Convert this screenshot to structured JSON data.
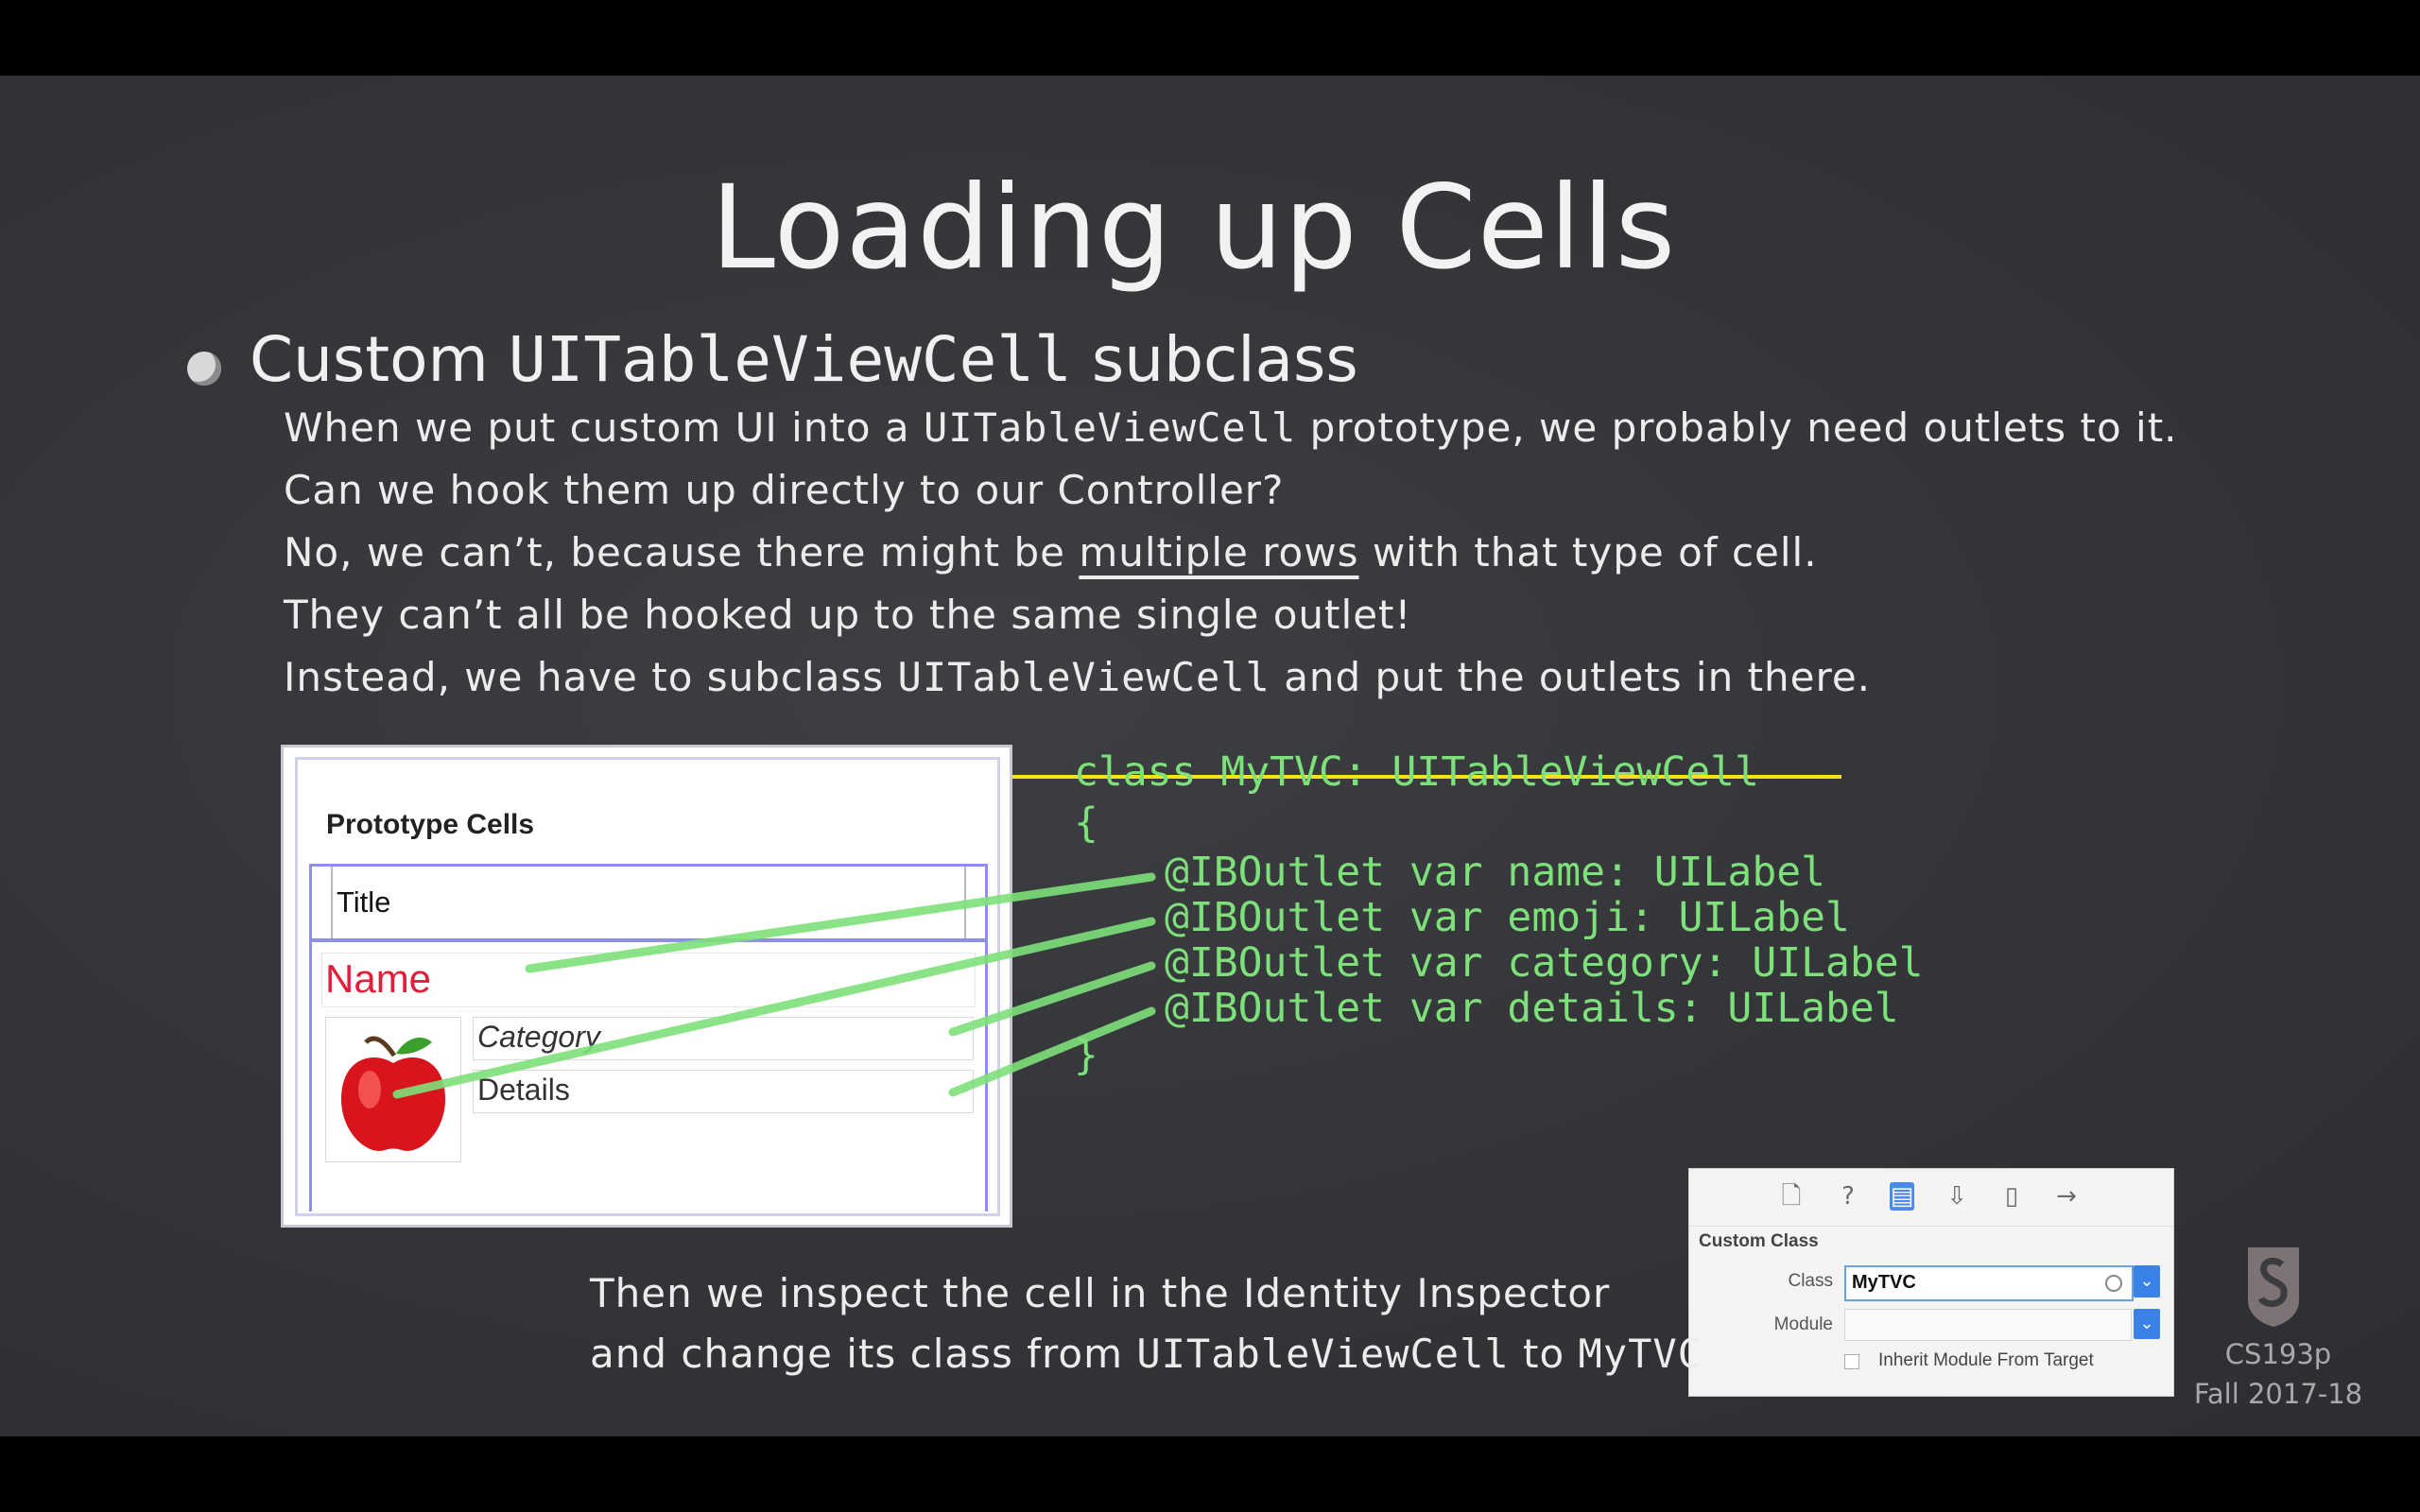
{
  "slide": {
    "title": "Loading up Cells",
    "bullet": {
      "prefix": "Custom ",
      "code": "UITableViewCell",
      "suffix": " subclass"
    },
    "lines": [
      {
        "a": "When we put custom UI into a ",
        "code": "UITableViewCell",
        "b": " prototype, we probably need outlets to it."
      },
      {
        "text": "Can we hook them up directly to our Controller?"
      },
      {
        "a": "No, we can’t, because there might be ",
        "u": "multiple rows",
        "b": " with that type of cell."
      },
      {
        "text": "They can’t all be hooked up to the same single outlet!"
      },
      {
        "a": "Instead, we have to ",
        "u1": "subclass ",
        "code": "UITableViewCell",
        "u2": " and put the outlets in there."
      }
    ],
    "caption": {
      "line1": "Then we inspect the cell in the Identity Inspector",
      "line2_a": "and change its class from ",
      "line2_code1": "UITableViewCell",
      "line2_b": " to ",
      "line2_code2": "MyTVC"
    },
    "course": {
      "name": "CS193p",
      "term": "Fall 2017-18"
    }
  },
  "storyboard": {
    "header": "Prototype Cells",
    "title_row": "Title",
    "name_label": "Name",
    "category_label": "Category",
    "details_label": "Details",
    "image_icon": "apple-icon"
  },
  "code": {
    "line1": "class MyTVC: UITableViewCell",
    "open_brace": "{",
    "outlets": [
      "@IBOutlet var name: UILabel",
      "@IBOutlet var emoji: UILabel",
      "@IBOutlet var category: UILabel",
      "@IBOutlet var details: UILabel"
    ],
    "close_brace": "}"
  },
  "inspector": {
    "tabs": [
      "file-icon",
      "help-icon",
      "identity-icon",
      "attributes-icon",
      "size-icon",
      "connections-icon"
    ],
    "section": "Custom Class",
    "class_label": "Class",
    "class_value": "MyTVC",
    "module_label": "Module",
    "inherit_label": "Inherit Module From Target"
  },
  "colors": {
    "chalkboard": "#34363a",
    "code_green": "#7ee07a",
    "underline_yellow": "#f4e21a",
    "name_red": "#e0203a",
    "selection_blue": "#3b82e6"
  }
}
